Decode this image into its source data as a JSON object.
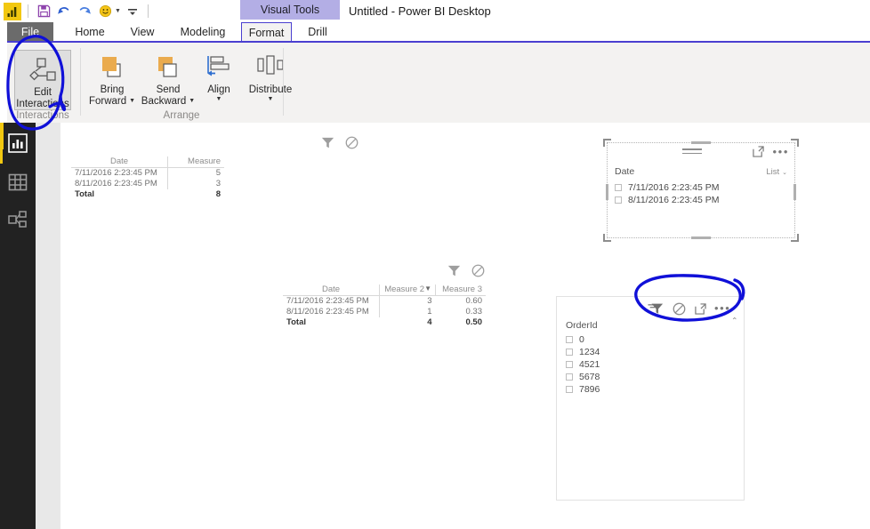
{
  "window": {
    "title": "Untitled - Power BI Desktop",
    "contextual_tab_banner": "Visual Tools"
  },
  "quick_access": {
    "app_icon": "power-bi-logo-icon",
    "items": [
      {
        "name": "save-icon",
        "label": "Save"
      },
      {
        "name": "undo-icon",
        "label": "Undo"
      },
      {
        "name": "redo-icon",
        "label": "Redo"
      },
      {
        "name": "smiley-feedback-icon",
        "label": "Send a Smile"
      },
      {
        "name": "customize-quick-access-toolbar-icon",
        "label": "Customize Quick Access Toolbar"
      }
    ]
  },
  "ribbon": {
    "file_tab": "File",
    "tabs": [
      {
        "label": "Home",
        "active": false
      },
      {
        "label": "View",
        "active": false
      },
      {
        "label": "Modeling",
        "active": false
      },
      {
        "label": "Format",
        "active": true
      },
      {
        "label": "Drill",
        "active": false
      }
    ],
    "groups": [
      {
        "name": "interactions",
        "label": "Interactions",
        "buttons": [
          {
            "name": "edit-interactions-button",
            "line1": "Edit",
            "line2": "Interactions",
            "selected": true,
            "has_caret": false
          }
        ]
      },
      {
        "name": "arrange",
        "label": "Arrange",
        "buttons": [
          {
            "name": "bring-forward-button",
            "line1": "Bring",
            "line2": "Forward",
            "selected": false,
            "has_caret": true
          },
          {
            "name": "send-backward-button",
            "line1": "Send",
            "line2": "Backward",
            "selected": false,
            "has_caret": true
          },
          {
            "name": "align-button",
            "line1": "Align",
            "line2": "",
            "selected": false,
            "has_caret": true
          },
          {
            "name": "distribute-button",
            "line1": "Distribute",
            "line2": "",
            "selected": false,
            "has_caret": true
          }
        ]
      }
    ]
  },
  "nav_rail": {
    "items": [
      {
        "name": "sidebar-item-report",
        "icon": "report-bar-chart-icon",
        "active": true
      },
      {
        "name": "sidebar-item-data",
        "icon": "data-grid-icon",
        "active": false
      },
      {
        "name": "sidebar-item-relationships",
        "icon": "relationships-icon",
        "active": false
      }
    ]
  },
  "canvas": {
    "visuals": [
      {
        "name": "table-visual-measure",
        "type": "table",
        "header_icons": [
          {
            "name": "filter-interaction-icon",
            "state": "inactive"
          },
          {
            "name": "none-interaction-icon",
            "state": "inactive"
          }
        ],
        "columns": [
          "Date",
          "Measure"
        ],
        "rows": [
          [
            "7/11/2016 2:23:45 PM",
            "5"
          ],
          [
            "8/11/2016 2:23:45 PM",
            "3"
          ]
        ],
        "total_row": [
          "Total",
          "8"
        ]
      },
      {
        "name": "table-visual-measure-2-3",
        "type": "table",
        "header_icons": [
          {
            "name": "filter-interaction-icon",
            "state": "inactive"
          },
          {
            "name": "none-interaction-icon",
            "state": "inactive"
          }
        ],
        "columns": [
          "Date",
          "Measure 2",
          "Measure 3"
        ],
        "sorted_column": "Measure 2",
        "rows": [
          [
            "7/11/2016 2:23:45 PM",
            "3",
            "0.60"
          ],
          [
            "8/11/2016 2:23:45 PM",
            "1",
            "0.33"
          ]
        ],
        "total_row": [
          "Total",
          "4",
          "0.50"
        ]
      },
      {
        "name": "slicer-visual-date",
        "type": "slicer",
        "selected": true,
        "title": "Date",
        "mode_label": "List",
        "header_icons": [
          {
            "name": "focus-mode-icon"
          },
          {
            "name": "more-options-icon"
          }
        ],
        "items": [
          {
            "label": "7/11/2016 2:23:45 PM",
            "checked": false
          },
          {
            "label": "8/11/2016 2:23:45 PM",
            "checked": false
          }
        ]
      },
      {
        "name": "slicer-visual-orderid",
        "type": "slicer",
        "selected": false,
        "title": "OrderId",
        "header_icons": [
          {
            "name": "filter-interaction-icon",
            "state": "active"
          },
          {
            "name": "none-interaction-icon",
            "state": "inactive"
          },
          {
            "name": "focus-mode-icon"
          },
          {
            "name": "more-options-icon"
          },
          {
            "name": "collapse-chevron-icon"
          }
        ],
        "items": [
          {
            "label": "0",
            "checked": false
          },
          {
            "label": "1234",
            "checked": false
          },
          {
            "label": "4521",
            "checked": false
          },
          {
            "label": "5678",
            "checked": false
          },
          {
            "label": "7896",
            "checked": false
          }
        ]
      }
    ]
  },
  "annotations": [
    {
      "name": "ink-circle-edit-interactions",
      "color": "#1010d8",
      "target": "edit-interactions-button"
    },
    {
      "name": "ink-circle-slicer-interaction-icons",
      "color": "#1010d8",
      "target": "slicer-visual-orderid-header-icons"
    }
  ],
  "colors": {
    "accent_purple": "#4a3fd0",
    "contextual_banner": "#b3aee5",
    "brand_yellow": "#f2c811",
    "ribbon_bg": "#f3f2f1",
    "nav_rail_bg": "#222222",
    "ink_blue": "#1010d8"
  }
}
